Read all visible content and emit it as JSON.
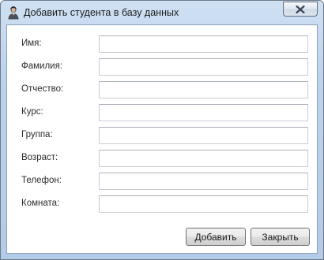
{
  "window": {
    "title": "Добавить студента в базу данных"
  },
  "form": {
    "fields": [
      {
        "label": "Имя:",
        "value": "",
        "placeholder": ""
      },
      {
        "label": "Фамилия:",
        "value": "",
        "placeholder": ""
      },
      {
        "label": "Отчество:",
        "value": "",
        "placeholder": ""
      },
      {
        "label": "Курс:",
        "value": "",
        "placeholder": ""
      },
      {
        "label": "Группа:",
        "value": "",
        "placeholder": ""
      },
      {
        "label": "Возраст:",
        "value": "",
        "placeholder": ""
      },
      {
        "label": "Телефон:",
        "value": "",
        "placeholder": ""
      },
      {
        "label": "Комната:",
        "value": "",
        "placeholder": ""
      }
    ]
  },
  "buttons": {
    "add_label": "Добавить",
    "close_label": "Закрыть"
  },
  "icons": {
    "app": "student-user-icon",
    "close": "close-x-icon"
  },
  "colors": {
    "titlebar": "#bdd3ec",
    "close_glyph": "#3a4656"
  }
}
